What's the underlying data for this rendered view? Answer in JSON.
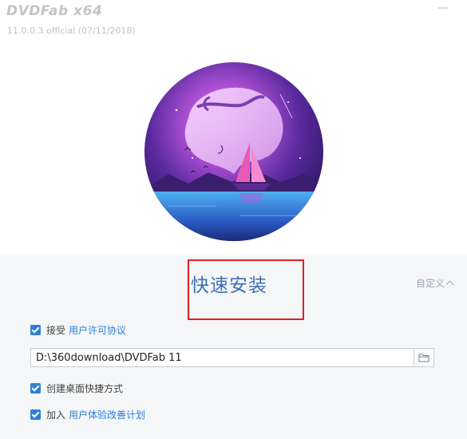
{
  "app": {
    "title": "DVDFab x64",
    "version": "11.0.0.3 official (07/11/2018)"
  },
  "window": {
    "minimize_symbol": "—"
  },
  "install": {
    "quick_install_label": "快速安装",
    "custom_label": "自定义"
  },
  "options": {
    "agree_prefix": "接受",
    "agree_link": "用户许可协议",
    "agree_checked": true,
    "install_path": "D:\\360download\\DVDFab 11",
    "desktop_shortcut_label": "创建桌面快捷方式",
    "desktop_shortcut_checked": true,
    "join_prefix": "加入",
    "join_link": "用户体验改善计划",
    "join_checked": true
  },
  "colors": {
    "accent": "#2e7fd8",
    "quick_install_text": "#3f6fb5",
    "highlight": "#e02020"
  },
  "icons": [
    "minimize-icon",
    "checkbox-checked-icon",
    "folder-icon",
    "chevron-up-icon"
  ]
}
